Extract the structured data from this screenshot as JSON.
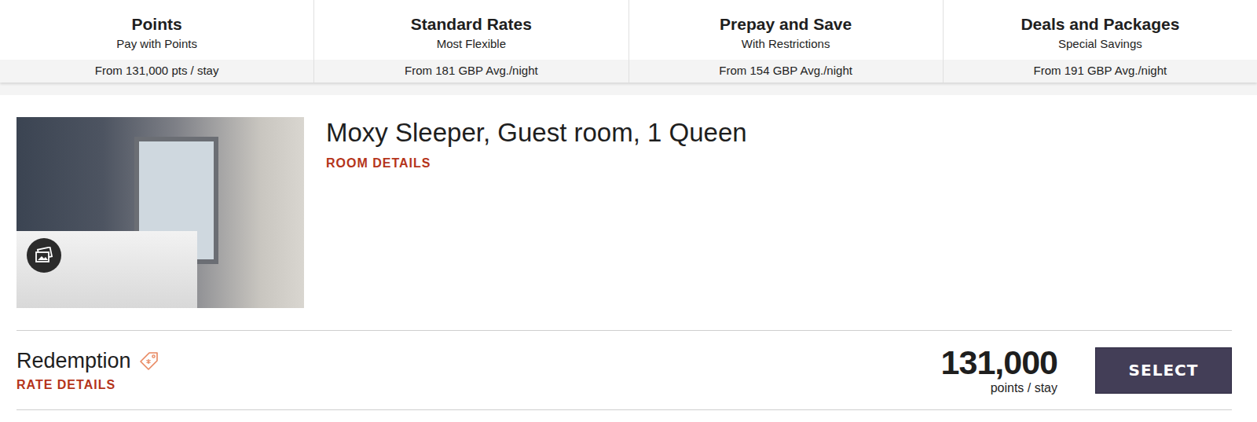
{
  "tabs": [
    {
      "title": "Points",
      "subtitle": "Pay with Points",
      "price": "From 131,000 pts / stay",
      "selected": false
    },
    {
      "title": "Standard Rates",
      "subtitle": "Most Flexible",
      "price": "From 181 GBP Avg./night",
      "selected": false
    },
    {
      "title": "Prepay and Save",
      "subtitle": "With Restrictions",
      "price": "From 154 GBP Avg./night",
      "selected": false
    },
    {
      "title": "Deals and Packages",
      "subtitle": "Special Savings",
      "price": "From 191 GBP Avg./night",
      "selected": false
    }
  ],
  "room": {
    "name": "Moxy Sleeper, Guest room, 1 Queen",
    "details_link": "ROOM DETAILS"
  },
  "rate": {
    "name": "Redemption",
    "details_link": "RATE DETAILS",
    "price": "131,000",
    "unit": "points / stay",
    "button": "SELECT"
  }
}
